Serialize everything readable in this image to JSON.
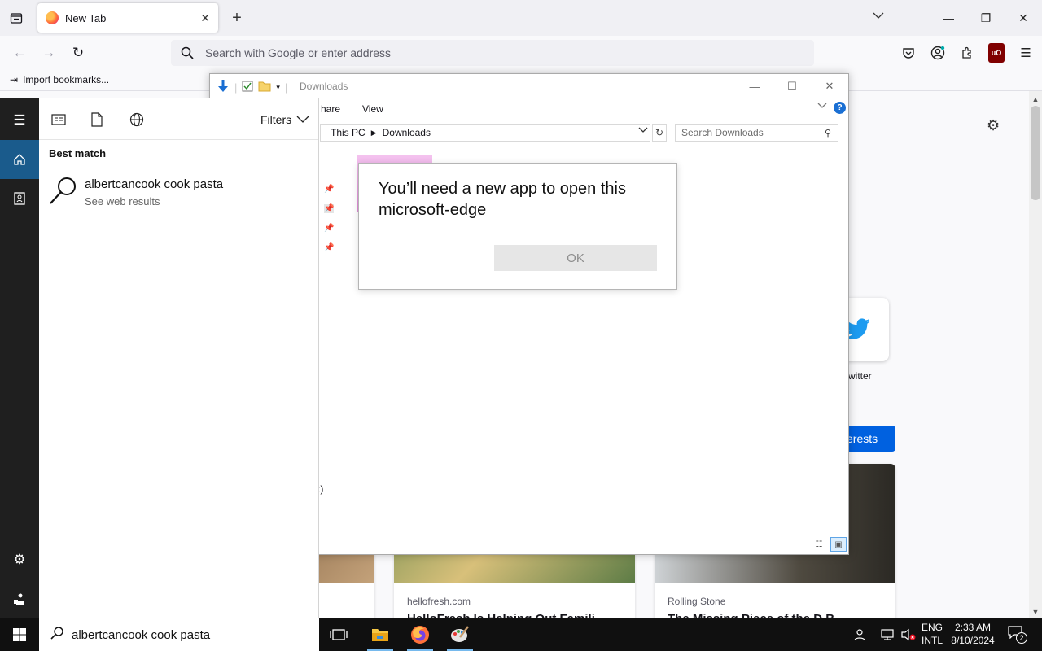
{
  "browser": {
    "tab_title": "New Tab",
    "url_placeholder": "Search with Google or enter address",
    "bookmark_item": "Import bookmarks..."
  },
  "newtab": {
    "site_label": "witter",
    "interests_label": "erests",
    "cards": [
      {
        "source": "hellofresh.com",
        "headline": "HelloFresh Is Helping Out Famili"
      },
      {
        "source": "Rolling Stone",
        "headline": "The Missing Piece of the D.B."
      }
    ]
  },
  "explorer": {
    "title": "Downloads",
    "ribbon_tabs": [
      "hare",
      "View"
    ],
    "breadcrumb": [
      "This PC",
      "Downloads"
    ],
    "search_placeholder": "Search Downloads",
    "status_fragment": ":)"
  },
  "dialog": {
    "message": "You’ll need a new app to open this microsoft-edge",
    "ok_label": "OK"
  },
  "search_panel": {
    "filters_label": "Filters",
    "heading": "Best match",
    "result_title": "albertcancook cook pasta",
    "result_subtitle": "See web results"
  },
  "taskbar": {
    "search_value": "albertcancook cook pasta",
    "lang_line1": "ENG",
    "lang_line2": "INTL",
    "time": "2:33 AM",
    "date": "8/10/2024",
    "notification_count": "2"
  },
  "colors": {
    "accent_blue": "#0061e0",
    "start_selected": "#1a5b8c",
    "taskbar_bg": "#101010"
  }
}
